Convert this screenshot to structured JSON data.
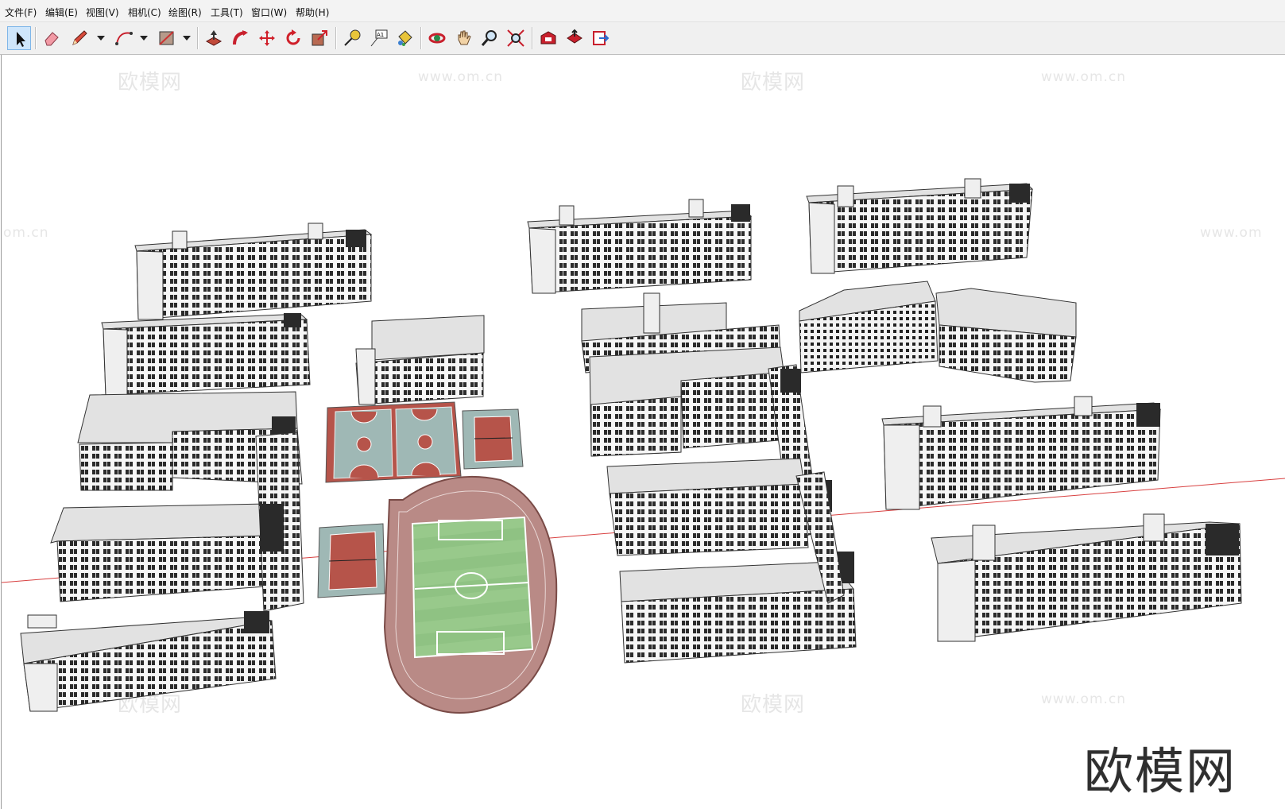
{
  "menu": [
    {
      "label": "文件(F)"
    },
    {
      "label": "编辑(E)"
    },
    {
      "label": "视图(V)"
    },
    {
      "label": "相机(C)"
    },
    {
      "label": "绘图(R)"
    },
    {
      "label": "工具(T)"
    },
    {
      "label": "窗口(W)"
    },
    {
      "label": "帮助(H)"
    }
  ],
  "toolbar": {
    "tools": [
      "select-icon",
      "eraser-icon",
      "pencil-icon",
      "arc-icon",
      "rectangle-icon",
      "push-pull-icon",
      "follow-me-icon",
      "move-icon",
      "rotate-icon",
      "scale-icon",
      "tape-measure-icon",
      "text-icon",
      "paint-bucket-icon",
      "orbit-icon",
      "pan-icon",
      "zoom-icon",
      "zoom-extents-icon",
      "warehouse-icon",
      "share-model-icon",
      "extension-icon"
    ],
    "text_tool_label": "A1"
  },
  "watermarks": {
    "logo": "欧模网",
    "url": "www.om.cn",
    "edge_url": "om.cn",
    "edge_url_right": "www.om"
  },
  "brand_logo": "欧模网",
  "colors": {
    "field_green": "#8fc283",
    "track_red": "#b98a86",
    "court_bg": "#9fb8b5",
    "court_red": "#b6544a",
    "roof": "#e1e1e1",
    "facade": "#f4f4f4",
    "axis_red": "#d84040"
  }
}
